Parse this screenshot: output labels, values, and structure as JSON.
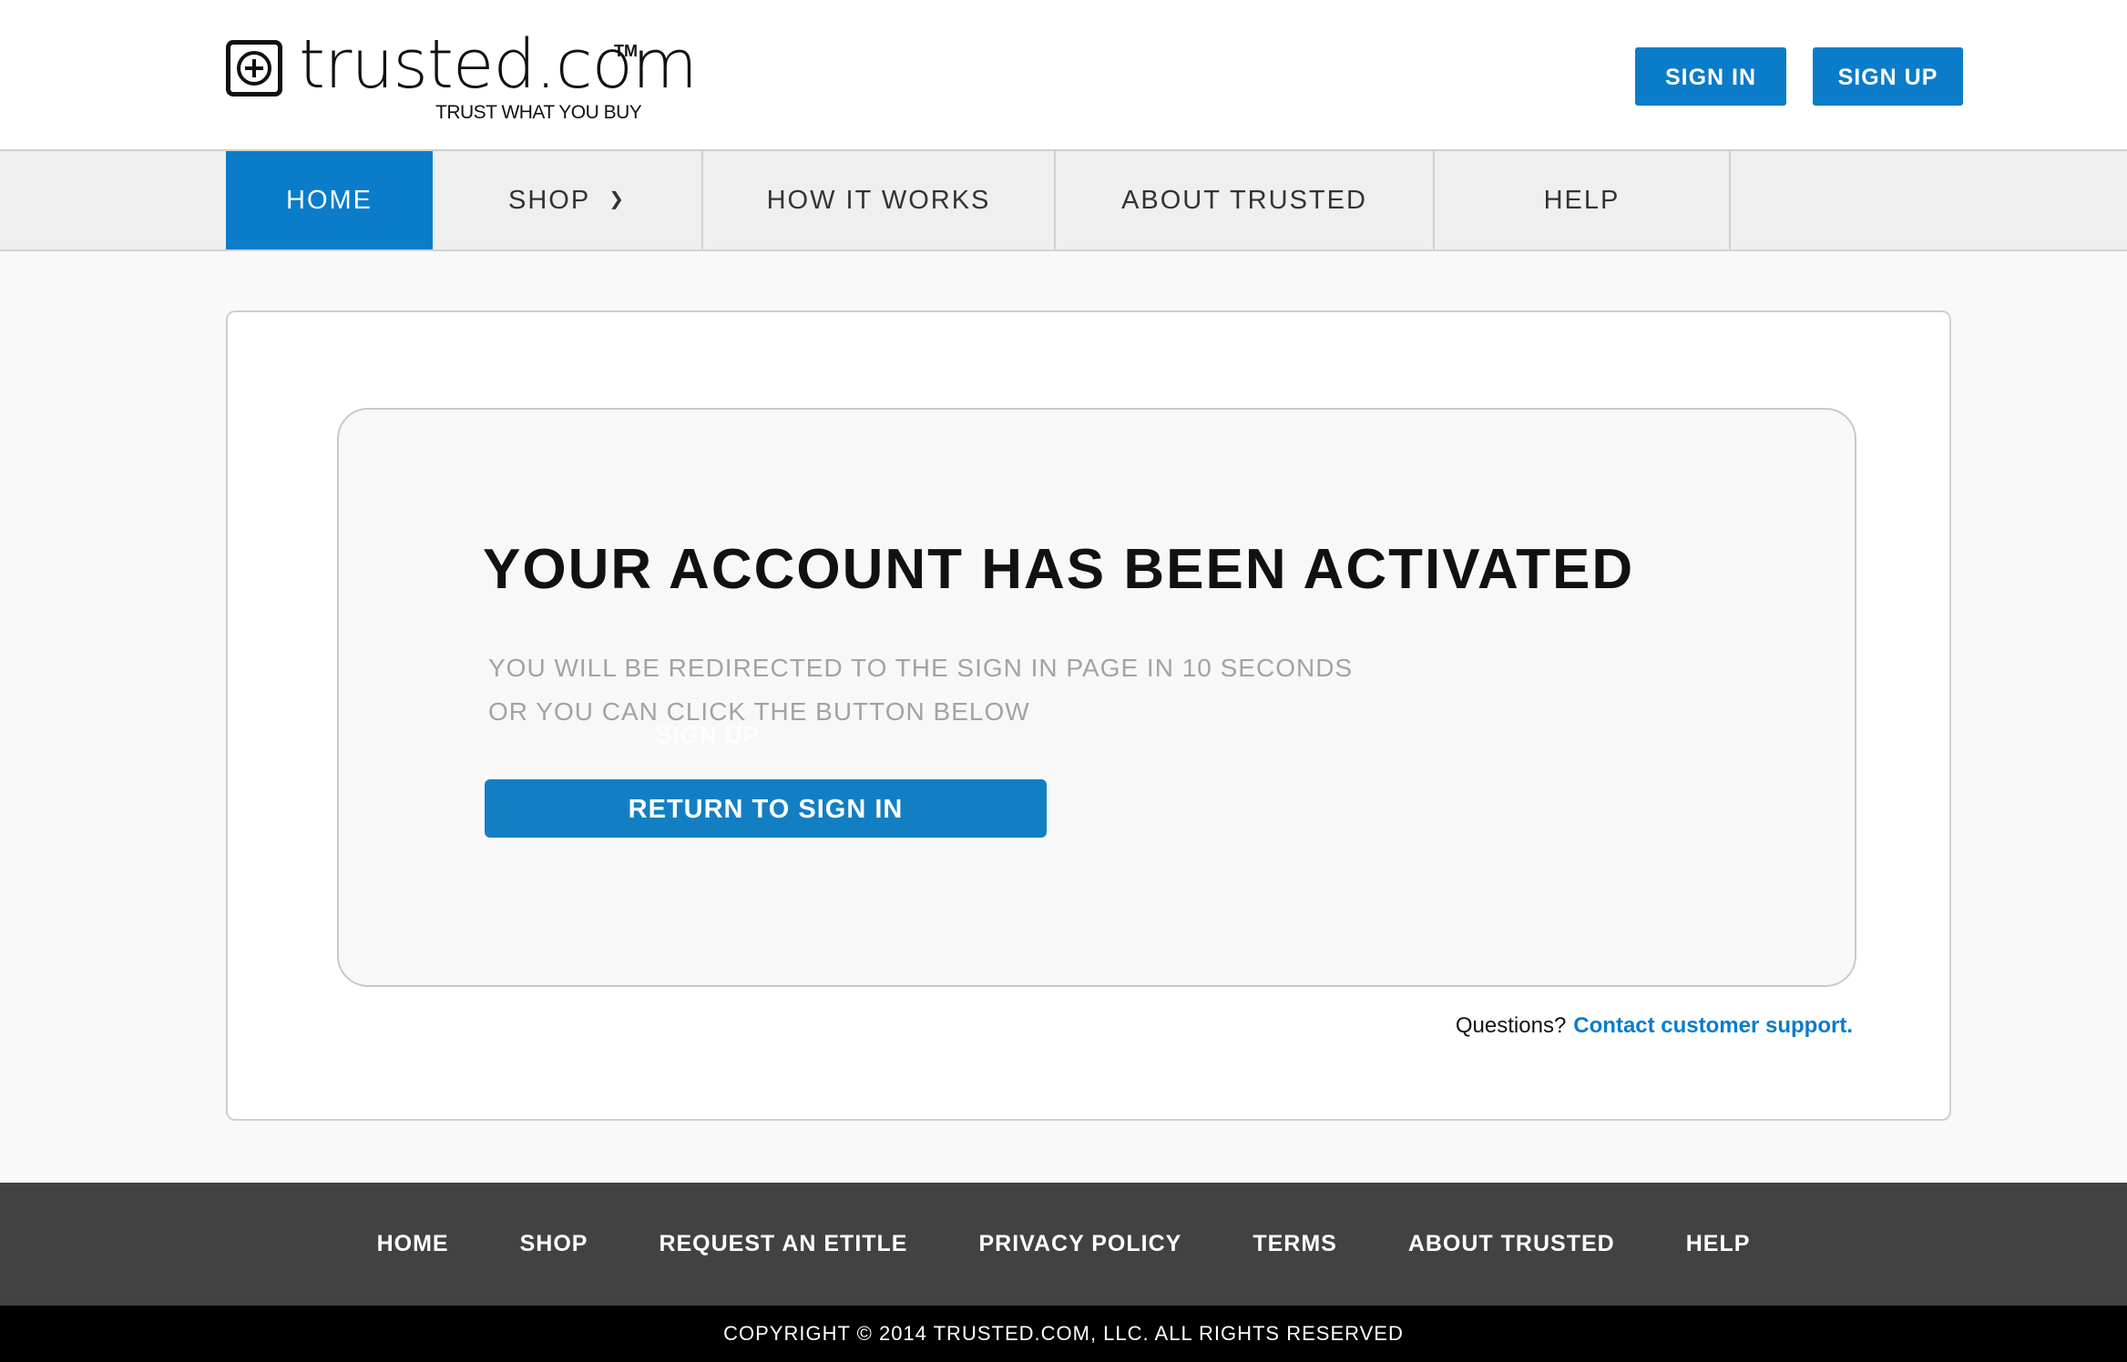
{
  "header": {
    "logo": {
      "word": "trusted.com",
      "tm": "TM",
      "tagline": "TRUST WHAT YOU BUY"
    },
    "sign_in_label": "SIGN IN",
    "sign_up_label": "SIGN UP"
  },
  "nav": {
    "items": [
      {
        "label": "HOME",
        "active": true
      },
      {
        "label": "SHOP",
        "icon": "chevron-down-icon"
      },
      {
        "label": "HOW IT WORKS"
      },
      {
        "label": "ABOUT TRUSTED"
      },
      {
        "label": "HELP"
      }
    ],
    "active_color": "#0a7cc9"
  },
  "main": {
    "title": "YOUR ACCOUNT HAS BEEN ACTIVATED",
    "message_line1": "YOU WILL BE REDIRECTED TO THE SIGN IN PAGE IN 10 SECONDS",
    "message_line2": "OR YOU CAN CLICK THE BUTTON BELOW",
    "ghost_text": "SIGN UP",
    "return_button_label": "RETURN TO SIGN IN",
    "questions_label": "Questions?",
    "support_link_label": "Contact customer support."
  },
  "footer": {
    "links": [
      "HOME",
      "SHOP",
      "REQUEST AN ETITLE",
      "PRIVACY POLICY",
      "TERMS",
      "ABOUT TRUSTED",
      "HELP"
    ],
    "copyright": "COPYRIGHT © 2014 TRUSTED.COM, LLC. ALL RIGHTS RESERVED"
  },
  "colors": {
    "brand_blue": "#0a7cc9",
    "footer_bg": "#424242",
    "copyright_bg": "#000000"
  }
}
